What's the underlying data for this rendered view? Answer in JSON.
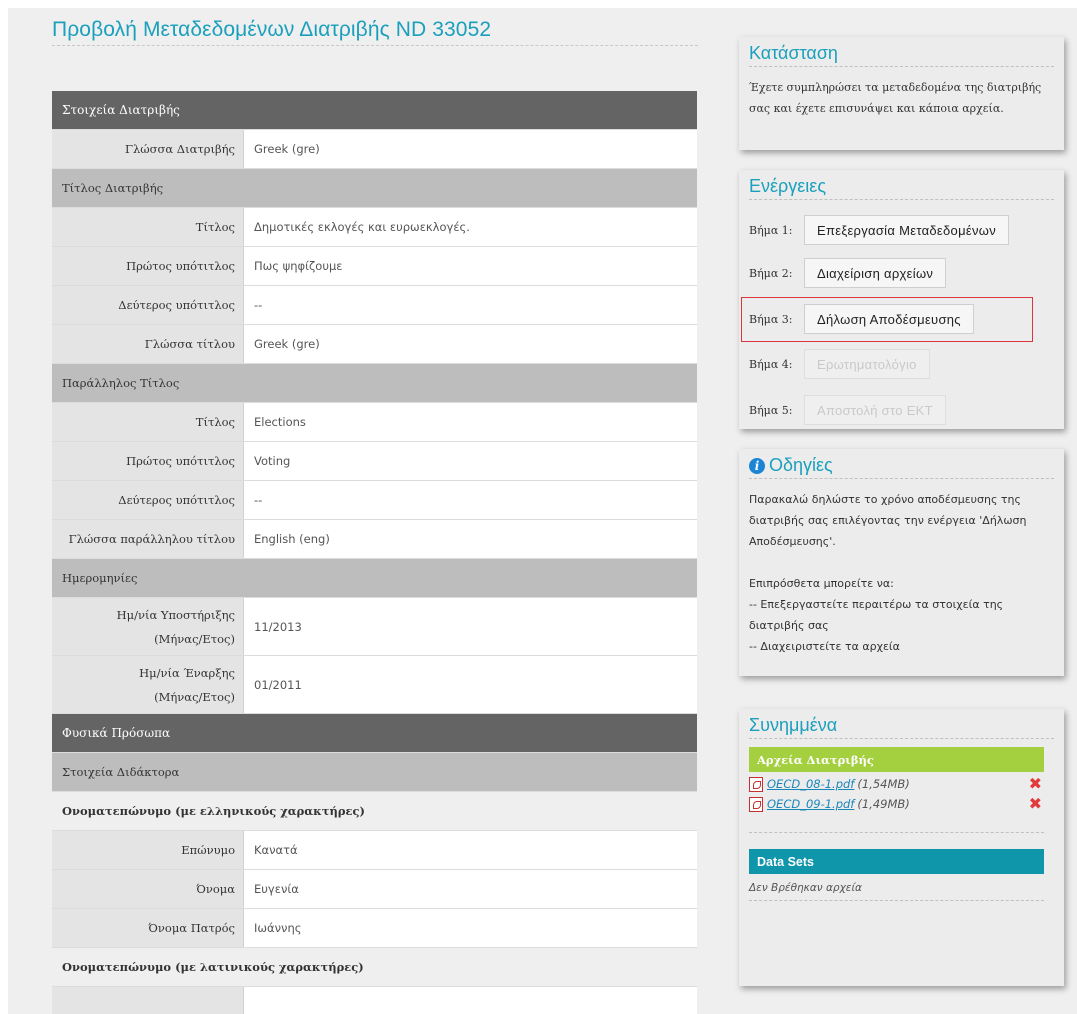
{
  "page_title": "Προβολή Μεταδεδομένων Διατριβής ND 33052",
  "table": {
    "section_thesis": "Στοιχεία Διατριβής",
    "thesis_language_label": "Γλώσσα Διατριβής",
    "thesis_language_value": "Greek (gre)",
    "title_section": "Τίτλος Διατριβής",
    "title_label": "Τίτλος",
    "title_value": "Δημοτικές εκλογές και ευρωεκλογές.",
    "subtitle1_label": "Πρώτος υπότιτλος",
    "subtitle1_value": "Πως ψηφίζουμε",
    "subtitle2_label": "Δεύτερος υπότιτλος",
    "subtitle2_value": "--",
    "title_lang_label": "Γλώσσα τίτλου",
    "title_lang_value": "Greek (gre)",
    "parallel_section": "Παράλληλος Τίτλος",
    "p_title_label": "Τίτλος",
    "p_title_value": "Elections",
    "p_subtitle1_label": "Πρώτος υπότιτλος",
    "p_subtitle1_value": "Voting",
    "p_subtitle2_label": "Δεύτερος υπότιτλος",
    "p_subtitle2_value": "--",
    "p_lang_label": "Γλώσσα παράλληλου τίτλου",
    "p_lang_value": "English (eng)",
    "dates_section": "Ημερομηνίες",
    "defense_label_1": "Ημ/νία Υποστήριξης",
    "defense_label_2": "(Μήνας/Ετος)",
    "defense_value": "11/2013",
    "start_label_1": "Ημ/νία Έναρξης",
    "start_label_2": "(Μήνας/Ετος)",
    "start_value": "01/2011",
    "persons_section": "Φυσικά Πρόσωπα",
    "doctor_section": "Στοιχεία Διδάκτορα",
    "name_greek_section": "Ονοματεπώνυμο (με ελληνικούς χαρακτήρες)",
    "surname_label": "Επώνυμο",
    "surname_value": "Κανατά",
    "firstname_label": "Όνομα",
    "firstname_value": "Ευγενία",
    "father_label": "Όνομα Πατρός",
    "father_value": "Ιωάννης",
    "name_latin_section": "Ονοματεπώνυμο (με λατινικούς χαρακτήρες)"
  },
  "status": {
    "title": "Κατάσταση",
    "text": "Έχετε συμπληρώσει τα μεταδεδομένα της διατριβής σας και έχετε επισυνάψει και κάποια αρχεία."
  },
  "actions": {
    "title": "Ενέργειες",
    "steps": [
      {
        "label": "Βήμα 1:",
        "button": "Επεξεργασία Μεταδεδομένων",
        "enabled": true
      },
      {
        "label": "Βήμα 2:",
        "button": "Διαχείριση αρχείων",
        "enabled": true
      },
      {
        "label": "Βήμα 3:",
        "button": "Δήλωση Αποδέσμευσης",
        "enabled": true,
        "highlighted": true
      },
      {
        "label": "Βήμα 4:",
        "button": "Ερωτηματολόγιο",
        "enabled": false
      },
      {
        "label": "Βήμα 5:",
        "button": "Αποστολή στο ΕΚΤ",
        "enabled": false
      }
    ]
  },
  "instructions": {
    "title": "Οδηγίες",
    "icon": "info-icon",
    "line1": "Παρακαλώ δηλώστε το χρόνο αποδέσμευσης της διατριβής σας επιλέγοντας την ενέργεια 'Δήλωση Αποδέσμευσης'.",
    "line2": "Επιπρόσθετα μπορείτε να:",
    "line3": "-- Επεξεργαστείτε περαιτέρω τα στοιχεία της διατριβής σας",
    "line4": "-- Διαχειριστείτε τα αρχεία"
  },
  "attachments": {
    "title": "Συνημμένα",
    "thesis_files_header": "Αρχεία Διατριβής",
    "files": [
      {
        "name": "OECD_08-1.pdf",
        "size": "(1,54MB)"
      },
      {
        "name": "OECD_09-1.pdf",
        "size": "(1,49MB)"
      }
    ],
    "datasets_header": "Data Sets",
    "datasets_empty": "Δεν Βρέθηκαν αρχεία"
  },
  "colors": {
    "accent": "#1aa0bc",
    "dark_header": "#646464",
    "green_bar": "#a4cf3e",
    "teal_bar": "#0f96ab",
    "highlight_border": "#d9363e"
  }
}
